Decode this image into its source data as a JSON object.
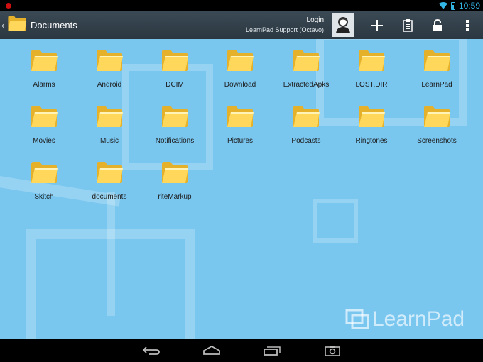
{
  "status_bar": {
    "time": "10:59",
    "icons": [
      "notification-dot-icon",
      "wifi-icon",
      "battery-icon"
    ]
  },
  "action_bar": {
    "title": "Documents",
    "account_label": "Login",
    "account_name": "LearnPad Support (Octavo)",
    "actions": [
      "avatar-icon",
      "add-icon",
      "clipboard-icon",
      "lock-icon",
      "overflow-menu-icon"
    ]
  },
  "folders": [
    {
      "label": "Alarms"
    },
    {
      "label": "Android"
    },
    {
      "label": "DCIM"
    },
    {
      "label": "Download"
    },
    {
      "label": "ExtractedApks"
    },
    {
      "label": "LOST.DIR"
    },
    {
      "label": "LearnPad"
    },
    {
      "label": "Movies"
    },
    {
      "label": "Music"
    },
    {
      "label": "Notifications"
    },
    {
      "label": "Pictures"
    },
    {
      "label": "Podcasts"
    },
    {
      "label": "Ringtones"
    },
    {
      "label": "Screenshots"
    },
    {
      "label": "Skitch"
    },
    {
      "label": "documents"
    },
    {
      "label": "riteMarkup"
    }
  ],
  "watermark": {
    "text": "LearnPad"
  },
  "nav_bar": {
    "buttons": [
      "back-icon",
      "home-icon",
      "recent-apps-icon",
      "screenshot-icon"
    ]
  },
  "colors": {
    "background": "#79c6ef",
    "action_bar": "#2f3c46",
    "folder": "#f6c93c",
    "accent": "#33b5e5"
  }
}
